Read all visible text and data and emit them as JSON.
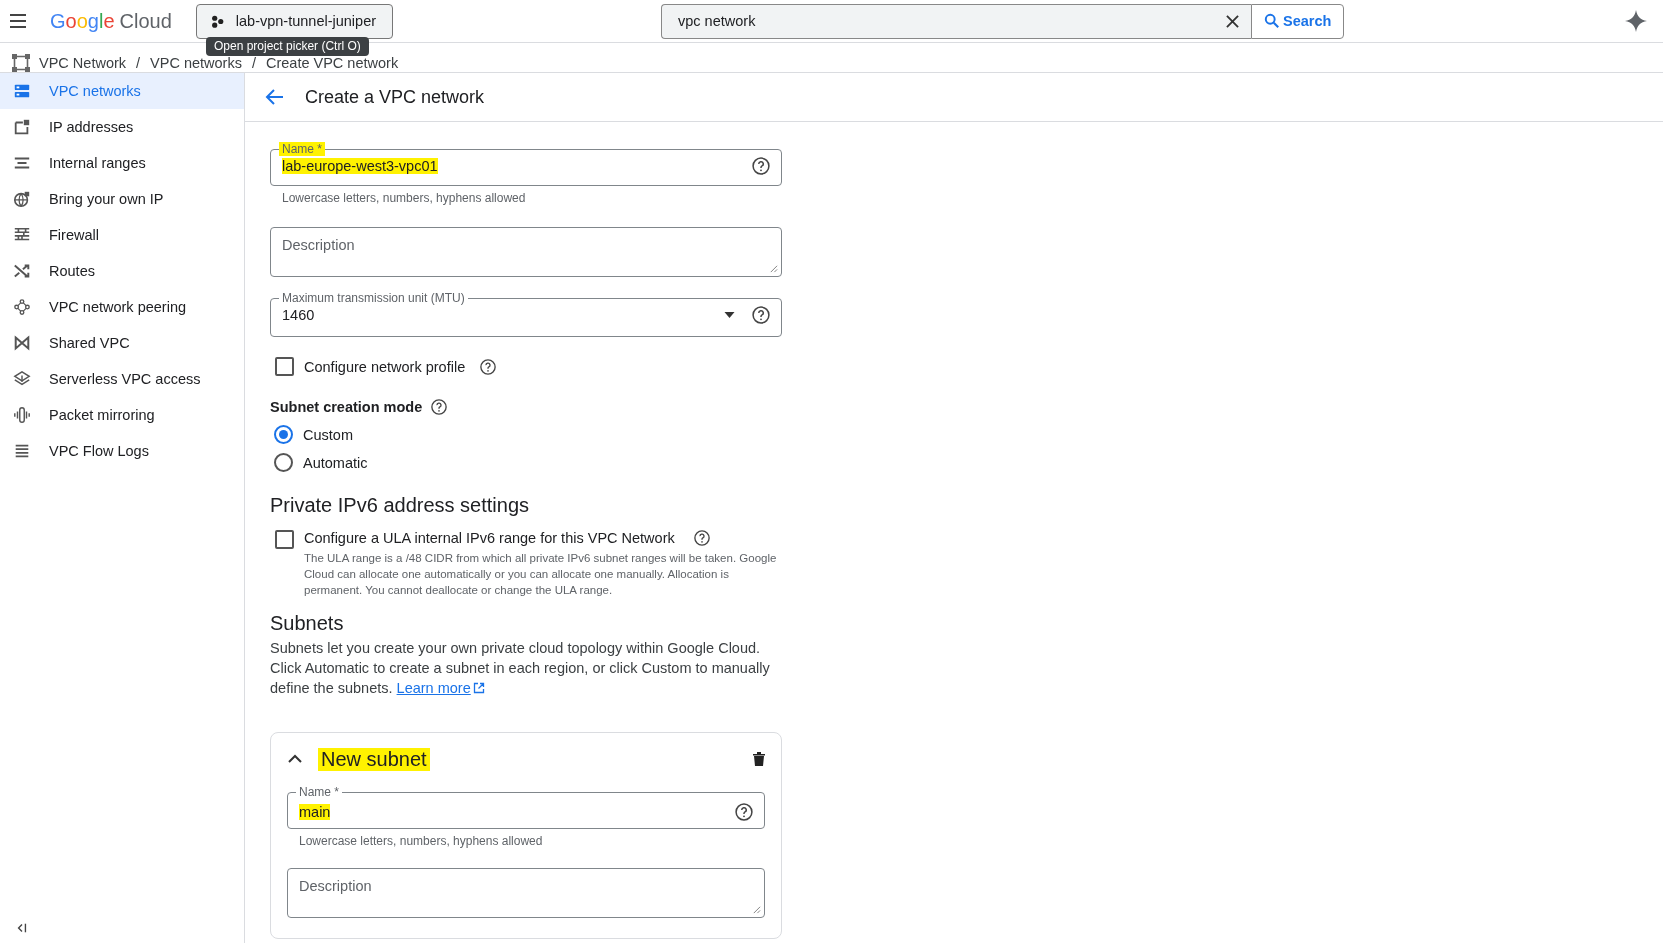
{
  "topbar": {
    "logo": {
      "brand": "Google",
      "product": "Cloud"
    },
    "project": "lab-vpn-tunnel-juniper",
    "search": {
      "value": "vpc network",
      "button": "Search"
    }
  },
  "tooltip": "Open project picker (Ctrl O)",
  "breadcrumb": {
    "separator": "/",
    "items": [
      "VPC Network",
      "VPC networks",
      "Create VPC network"
    ]
  },
  "sidebar": {
    "items": [
      {
        "label": "VPC networks",
        "selected": true
      },
      {
        "label": "IP addresses",
        "selected": false
      },
      {
        "label": "Internal ranges",
        "selected": false
      },
      {
        "label": "Bring your own IP",
        "selected": false
      },
      {
        "label": "Firewall",
        "selected": false
      },
      {
        "label": "Routes",
        "selected": false
      },
      {
        "label": "VPC network peering",
        "selected": false
      },
      {
        "label": "Shared VPC",
        "selected": false
      },
      {
        "label": "Serverless VPC access",
        "selected": false
      },
      {
        "label": "Packet mirroring",
        "selected": false
      },
      {
        "label": "VPC Flow Logs",
        "selected": false
      }
    ]
  },
  "page": {
    "title": "Create a VPC network"
  },
  "form": {
    "name": {
      "label": "Name *",
      "label_highlighted": true,
      "value": "lab-europe-west3-vpc01",
      "value_highlighted": true,
      "hint": "Lowercase letters, numbers, hyphens allowed"
    },
    "description": {
      "placeholder": "Description"
    },
    "mtu": {
      "label": "Maximum transmission unit (MTU)",
      "value": "1460"
    },
    "network_profile": {
      "label": "Configure network profile",
      "checked": false
    },
    "subnet_mode": {
      "label": "Subnet creation mode",
      "options": [
        {
          "label": "Custom",
          "selected": true
        },
        {
          "label": "Automatic",
          "selected": false
        }
      ]
    },
    "ipv6": {
      "heading": "Private IPv6 address settings",
      "label": "Configure a ULA internal IPv6 range for this VPC Network",
      "checked": false,
      "help": "The ULA range is a /48 CIDR from which all private IPv6 subnet ranges will be taken. Google Cloud can allocate one automatically or you can allocate one manually. Allocation is permanent. You cannot deallocate or change the ULA range."
    },
    "subnets": {
      "heading": "Subnets",
      "text": "Subnets let you create your own private cloud topology within Google Cloud. Click Automatic to create a subnet in each region, or click Custom to manually define the subnets.",
      "link": "Learn more"
    },
    "subnet": {
      "title": "New subnet",
      "title_highlighted": true,
      "expanded": true,
      "name": {
        "label": "Name *",
        "label_highlighted": false,
        "value": "main",
        "value_highlighted": true,
        "hint": "Lowercase letters, numbers, hyphens allowed"
      },
      "description": {
        "placeholder": "Description"
      }
    }
  }
}
